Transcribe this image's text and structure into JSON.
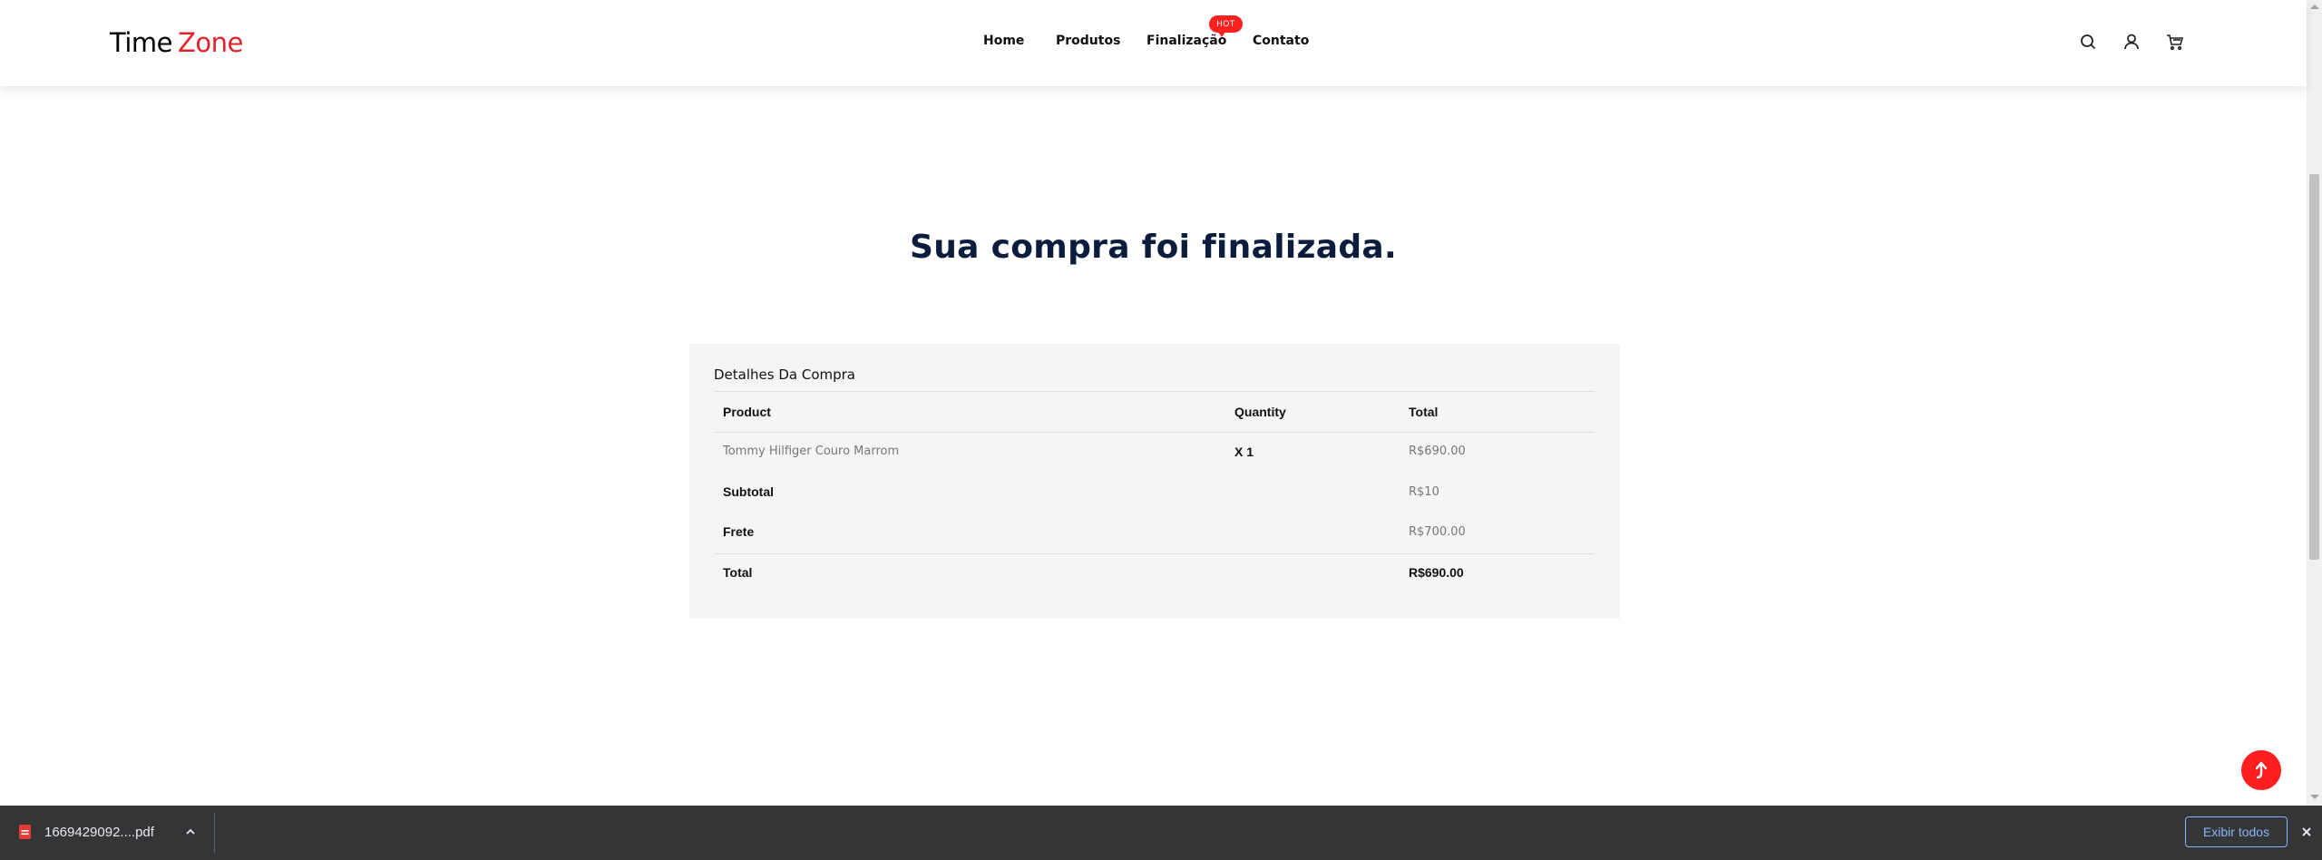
{
  "header": {
    "logo_part1": "Time",
    "logo_part2": "Zone",
    "nav": [
      "Home",
      "Produtos",
      "Finalização",
      "Contato"
    ],
    "badge": "HOT",
    "icons": [
      "search-icon",
      "user-icon",
      "cart-icon"
    ]
  },
  "main": {
    "title": "Sua compra foi finalizada.",
    "details": {
      "heading": "Detalhes Da Compra",
      "columns": [
        "Product",
        "Quantity",
        "Total"
      ],
      "item": {
        "product": "Tommy Hilfiger Couro Marrom",
        "quantity": "X 1",
        "total": "R$690.00"
      },
      "subtotal_label": "Subtotal",
      "subtotal_value": "R$10",
      "frete_label": "Frete",
      "frete_value": "R$700.00",
      "total_label": "Total",
      "total_value": "R$690.00"
    }
  },
  "download_bar": {
    "file_name": "1669429092....pdf",
    "show_all": "Exibir todos"
  },
  "colors": {
    "accent": "#e3222b",
    "title": "#0b1c3d",
    "card_bg": "#f5f5f5",
    "download_bar": "#333537",
    "link_blue": "#8ab4f8"
  }
}
